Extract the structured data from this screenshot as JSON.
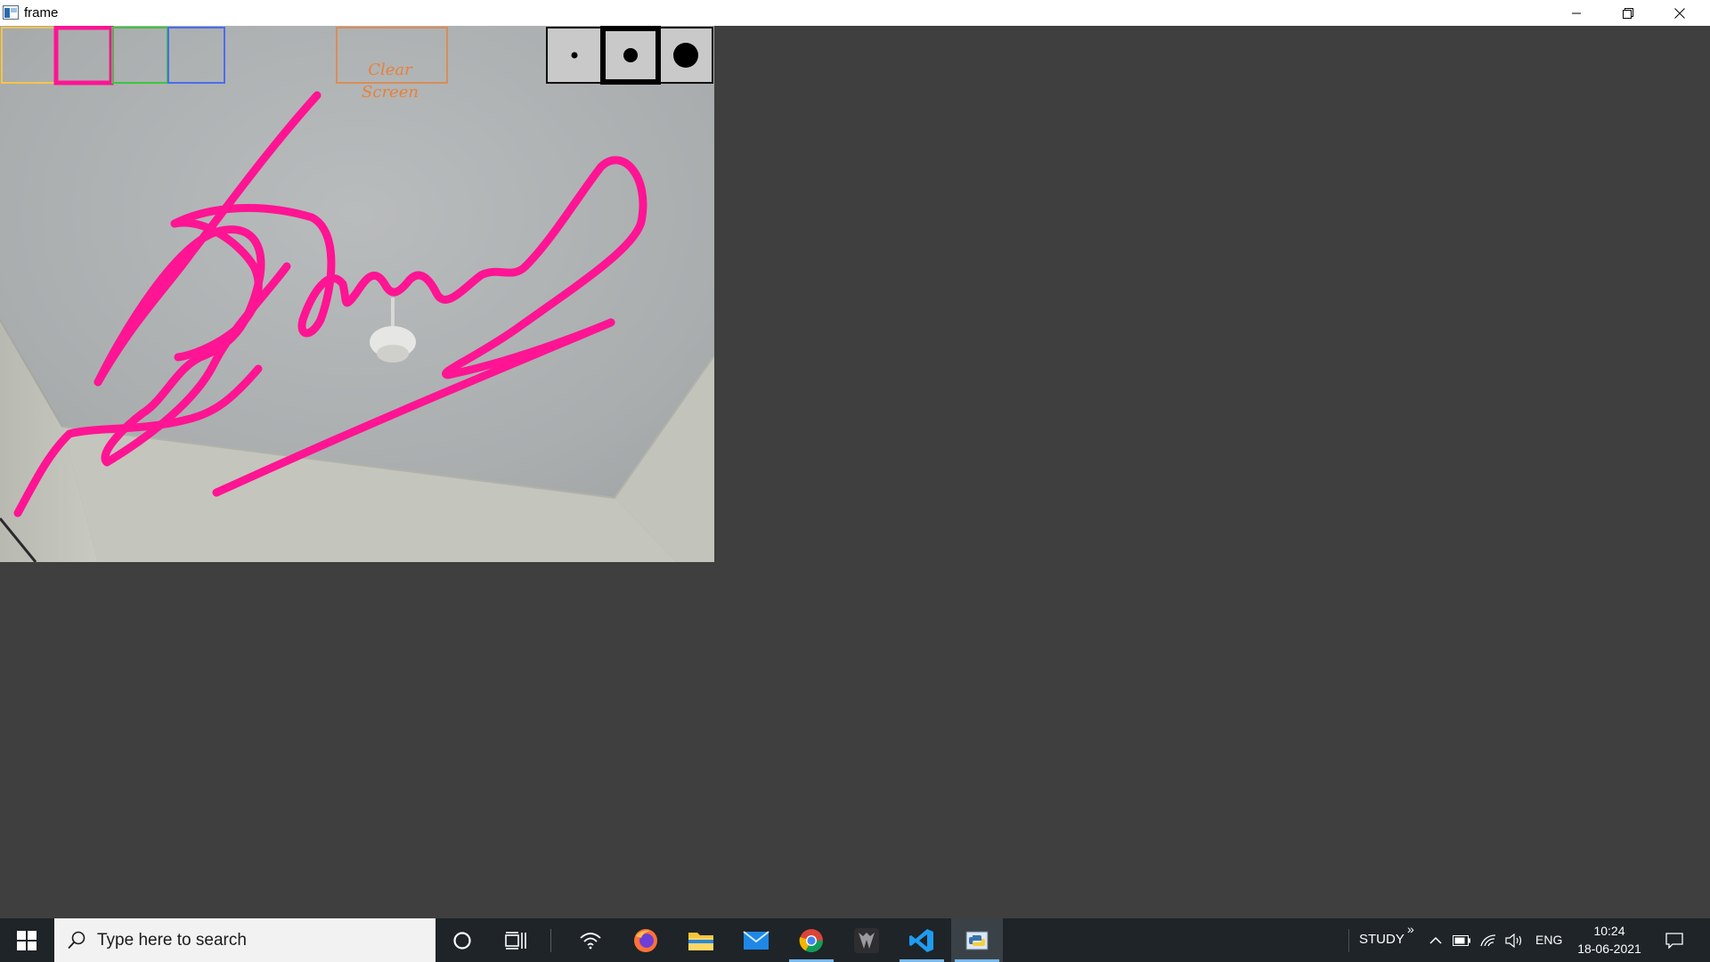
{
  "window": {
    "title": "frame",
    "controls": [
      "minimize-icon",
      "restore-icon",
      "close-icon"
    ]
  },
  "canvas": {
    "color_swatches": [
      {
        "name": "yellow",
        "color": "#f5c44a"
      },
      {
        "name": "pink",
        "color": "#ff1493"
      },
      {
        "name": "green",
        "color": "#3ec43e"
      },
      {
        "name": "blue",
        "color": "#4a6cf0"
      }
    ],
    "selected_color": "pink",
    "clear_button_label": "Clear\nScreen",
    "clear_button_color": "#e8803a",
    "brush_sizes": [
      "small",
      "medium",
      "large"
    ],
    "selected_brush": "medium",
    "stroke_color": "#ff1493"
  },
  "taskbar": {
    "search_placeholder": "Type here to search",
    "pinned_icons": [
      "cortana-icon",
      "task-view-icon",
      "wifi-icon",
      "firefox-icon",
      "file-explorer-icon",
      "mail-icon",
      "chrome-icon",
      "game-app-icon",
      "vscode-icon",
      "python-icon"
    ],
    "active_apps": [
      "chrome-icon",
      "vscode-icon",
      "python-icon"
    ],
    "focused_app": "python-icon",
    "toolbar_label": "STUDY",
    "language": "ENG",
    "time": "10:24",
    "date": "18-06-2021"
  }
}
